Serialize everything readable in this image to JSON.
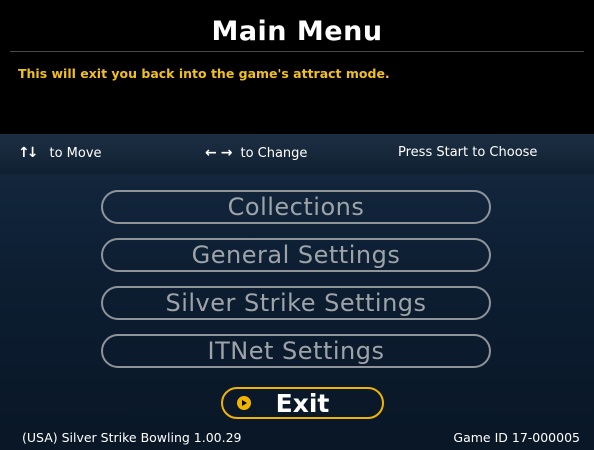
{
  "header": {
    "title": "Main Menu"
  },
  "help": {
    "text": "This will exit you back into the game's attract mode."
  },
  "nav": {
    "move_icon": "up-down-arrows",
    "move_label": "to Move",
    "change_icon": "left-right-arrows",
    "change_label": "to Change",
    "start_label": "Press Start to Choose"
  },
  "menu": {
    "items": [
      {
        "label": "Collections"
      },
      {
        "label": "General Settings"
      },
      {
        "label": "Silver Strike Settings"
      },
      {
        "label": "ITNet Settings"
      }
    ],
    "selected": {
      "label": "Exit",
      "icon": "chevron-right-icon"
    }
  },
  "footer": {
    "version": "(USA) Silver Strike Bowling 1.00.29",
    "game_id": "Game ID 17-000005"
  },
  "colors": {
    "accent": "#f0b400",
    "help_text": "#f0c020",
    "menu_border": "#8f9499",
    "menu_text": "#9ea3a8",
    "background_top": "#12263c",
    "background_bottom": "#091727"
  }
}
